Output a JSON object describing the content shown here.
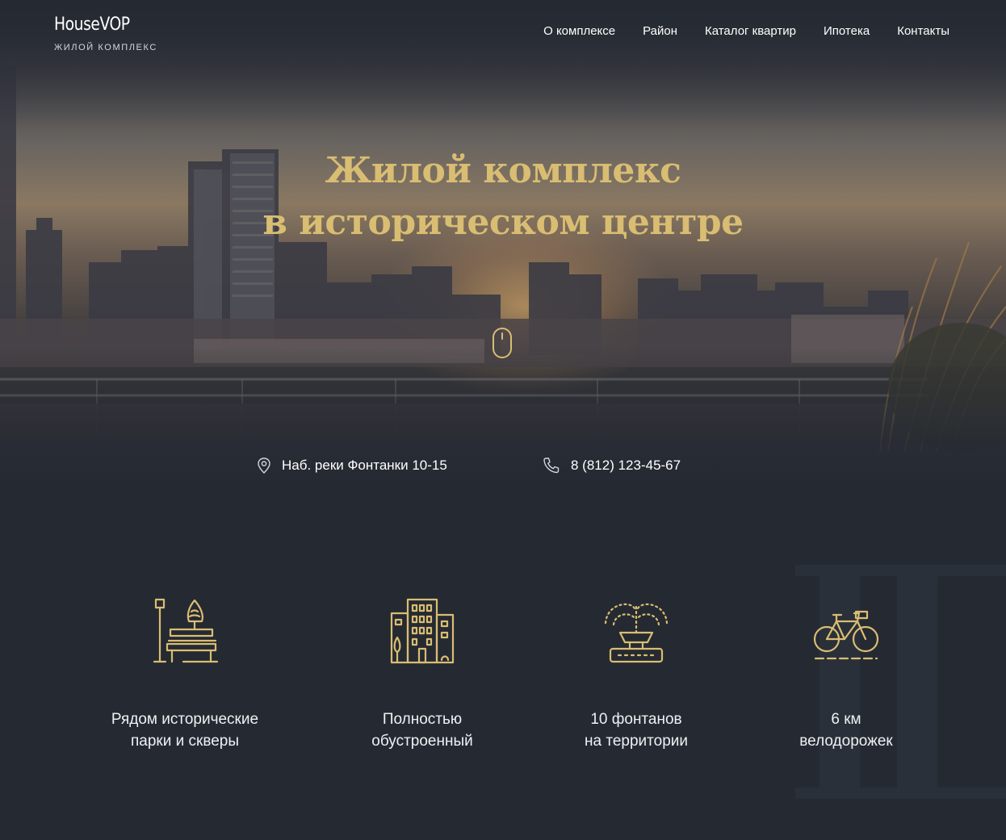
{
  "header": {
    "logo_name": "HouseVOP",
    "logo_sub": "ЖИЛОЙ КОМПЛЕКС",
    "nav": [
      "О комплексе",
      "Район",
      "Каталог квартир",
      "Ипотека",
      "Контакты"
    ]
  },
  "hero": {
    "title_line1": "Жилой комплекс",
    "title_line2": "в историческом центре",
    "scroll_icon": "mouse-icon"
  },
  "contacts": {
    "address": "Наб. реки Фонтанки 10-15",
    "address_icon": "location-pin-icon",
    "phone": "8 (812) 123-45-67",
    "phone_icon": "phone-icon"
  },
  "features": [
    {
      "icon": "park-bench-icon",
      "line1": "Рядом исторические",
      "line2": "парки и скверы"
    },
    {
      "icon": "building-icon",
      "line1": "Полностью",
      "line2": "обустроенный"
    },
    {
      "icon": "fountain-icon",
      "line1": "10 фонтанов",
      "line2": "на территории"
    },
    {
      "icon": "bicycle-icon",
      "line1": "6 км",
      "line2": "велодорожек"
    }
  ],
  "colors": {
    "background": "#252a32",
    "accent_gold": "#d9bd72",
    "text": "#ffffff"
  }
}
